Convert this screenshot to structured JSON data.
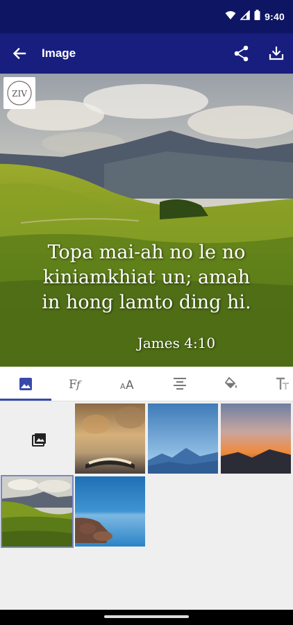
{
  "status_bar": {
    "time": "9:40",
    "icons": [
      "wifi-icon",
      "signal-icon",
      "battery-icon"
    ]
  },
  "app_bar": {
    "title": "Image",
    "back_icon": "arrow-left-icon",
    "share_icon": "share-icon",
    "download_icon": "download-icon"
  },
  "preview": {
    "logo_text": "ZIV",
    "verse_lines": [
      "Topa mai-ah no le no",
      "kiniamkhiat un; amah",
      "in hong lamto ding hi."
    ],
    "reference": "James 4:10"
  },
  "toolbar": {
    "tools": [
      "image-icon",
      "font-style-icon",
      "font-size-icon",
      "align-center-icon",
      "fill-color-icon",
      "text-format-icon"
    ],
    "active_tab": "image-icon",
    "accent": "#3949ab"
  },
  "gallery": {
    "add_icon": "add-photo-icon",
    "selected_index": 4,
    "thumbnails": [
      "book-sunset",
      "blue-mountains",
      "orange-sunset",
      "green-hills",
      "blue-lake-rocks"
    ]
  },
  "colors": {
    "status_bar": "#0e1563",
    "app_bar": "#171e7e",
    "selection": "#7986cb"
  }
}
